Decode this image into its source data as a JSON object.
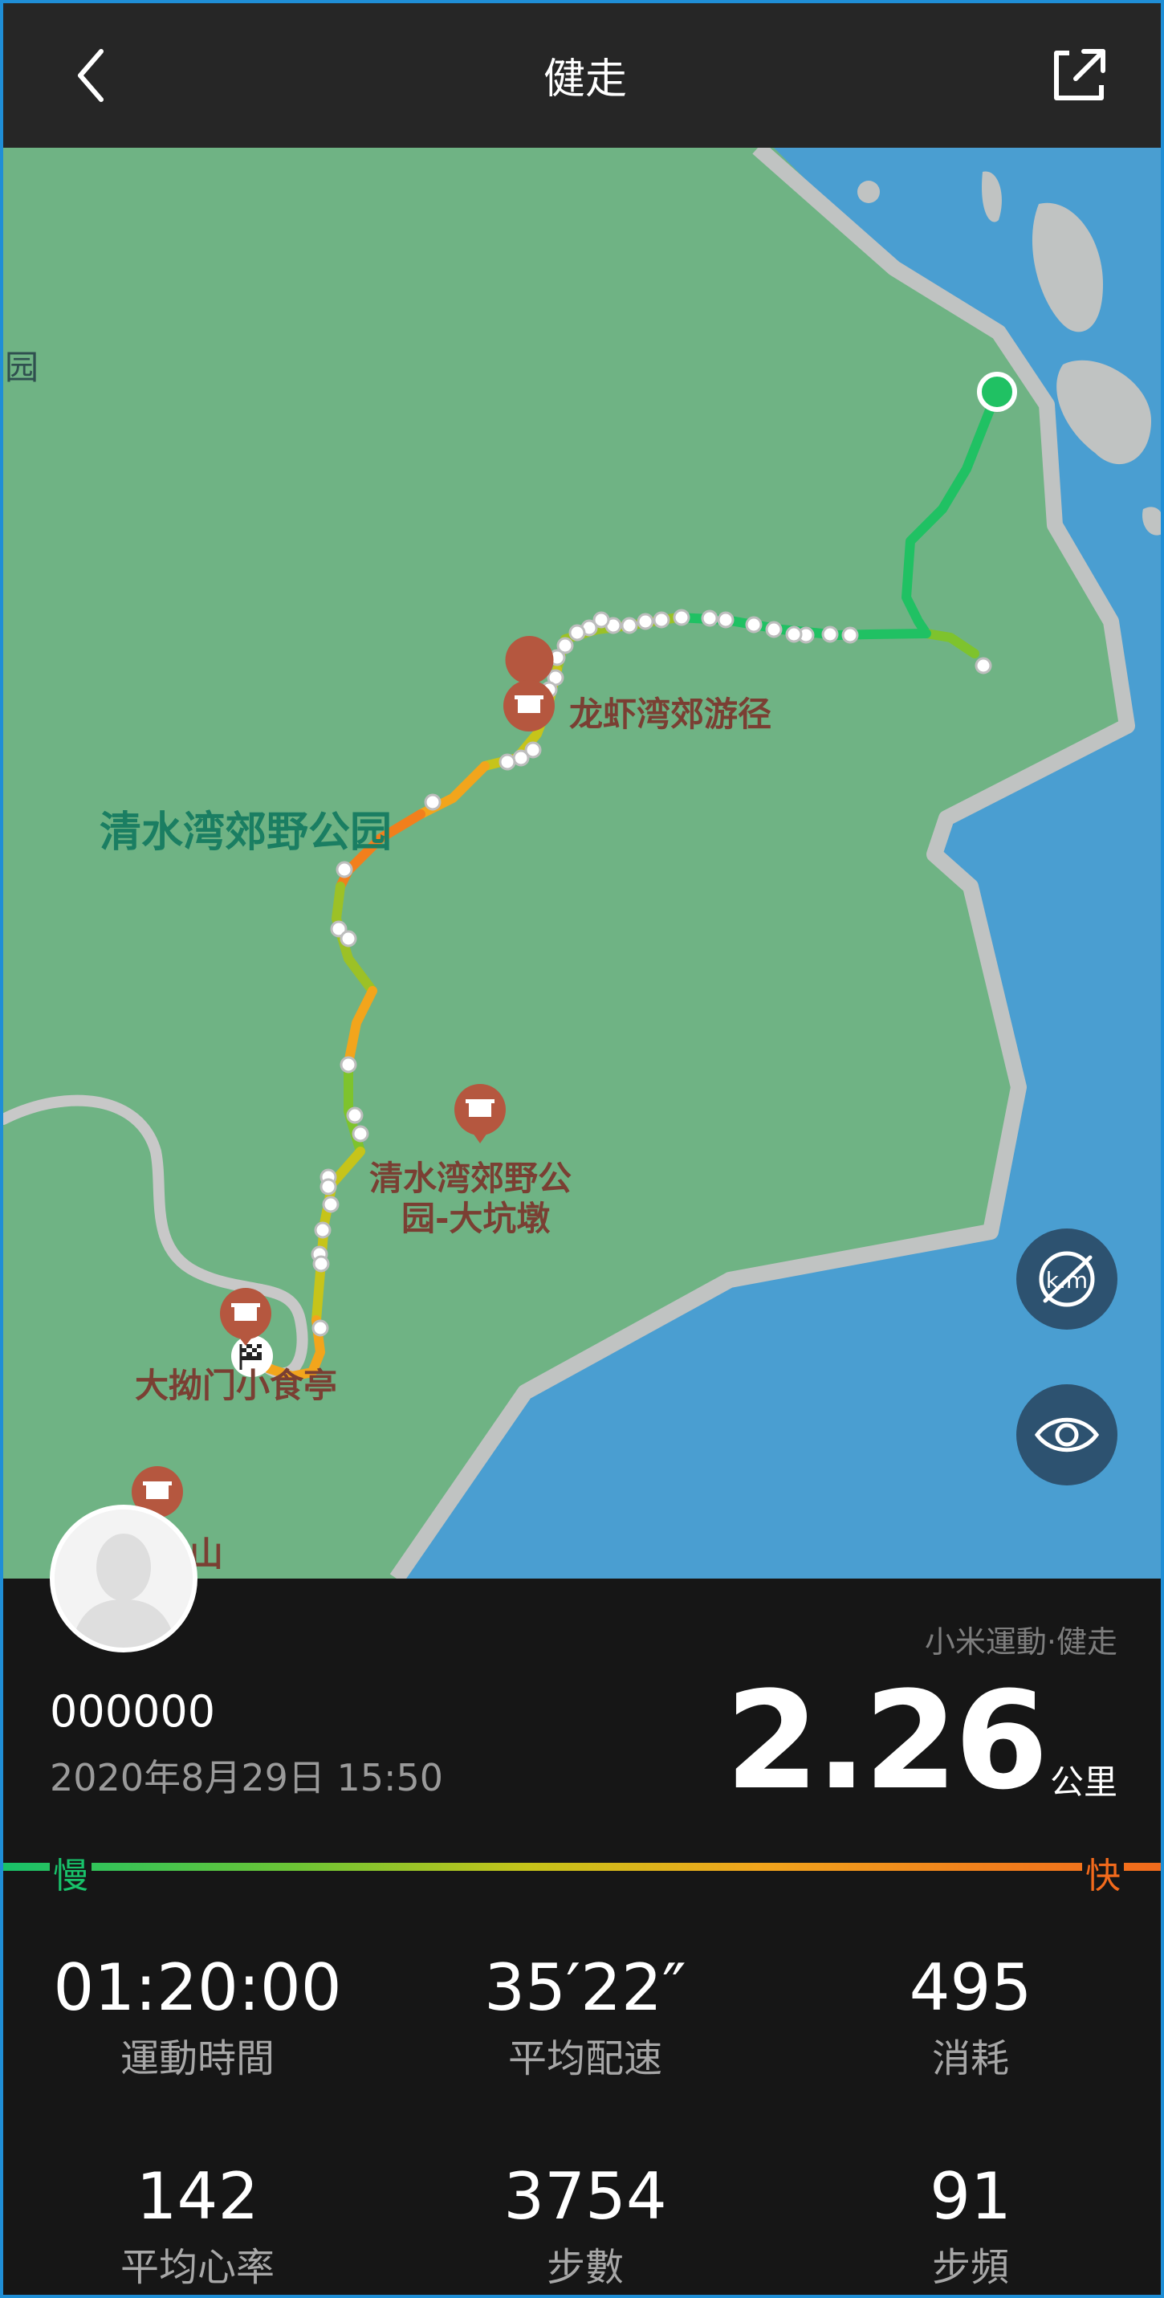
{
  "header": {
    "title": "健走"
  },
  "map": {
    "labels": {
      "trail": "龙虾湾郊游径",
      "park": "清水湾郊野公园",
      "poi2_line1": "清水湾郊野公",
      "poi2_line2": "园-大坑墩",
      "kiosk": "大拗门小食亭",
      "edge": "园",
      "partial": "山"
    }
  },
  "summary": {
    "app_label": "小米運動·健走",
    "username": "000000",
    "date": "2020年8月29日 15:50",
    "distance": "2.26",
    "distance_unit": "公里",
    "scale_slow": "慢",
    "scale_fast": "快"
  },
  "stats": [
    {
      "value": "01:20:00",
      "label": "運動時間"
    },
    {
      "value": "35′22″",
      "label": "平均配速"
    },
    {
      "value": "495",
      "label": "消耗"
    },
    {
      "value": "142",
      "label": "平均心率"
    },
    {
      "value": "3754",
      "label": "步數"
    },
    {
      "value": "91",
      "label": "步頻"
    }
  ],
  "colors": {
    "water": "#4a9ed1",
    "land": "#6fb384",
    "road": "#c8c8c8",
    "accent_slow": "#18c26a",
    "accent_fast": "#f26a1c"
  },
  "icons": [
    "back-arrow-icon",
    "share-icon",
    "poi-marker-icon",
    "finish-flag-icon",
    "start-point-icon",
    "km-hide-icon",
    "eye-icon",
    "avatar-icon"
  ]
}
